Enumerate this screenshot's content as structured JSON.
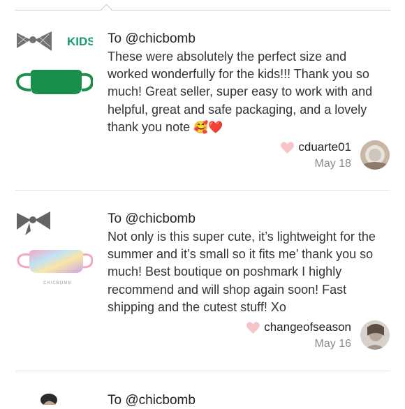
{
  "colors": {
    "heart": "#f7c4c8",
    "mask_green": "#1a8f4c",
    "kids_label": "#1a9a6e",
    "date_gray": "#8a8a8a"
  },
  "reviews": [
    {
      "to": "To @chicbomb",
      "text": "These were absolutely the perfect size and worked wonderfully for the kids!!! Thank you so much! Great seller, super easy to work with and helpful, great and safe packaging, and a lovely thank you note",
      "emoji": "🥰❤️",
      "username": "cduarte01",
      "date": "May 18",
      "thumb_label": "KIDS"
    },
    {
      "to": "To @chicbomb",
      "text": "Not only is this super cute, it’s lightweight for the summer and it’s small so it fits me’ thank you so much! Best boutique on poshmark I highly recommend and will shop again soon! Fast shipping and the cutest stuff! Xo",
      "emoji": "",
      "username": "changeofseason",
      "date": "May 16",
      "thumb_label": "CHICBOMB"
    },
    {
      "to": "To @chicbomb"
    }
  ]
}
